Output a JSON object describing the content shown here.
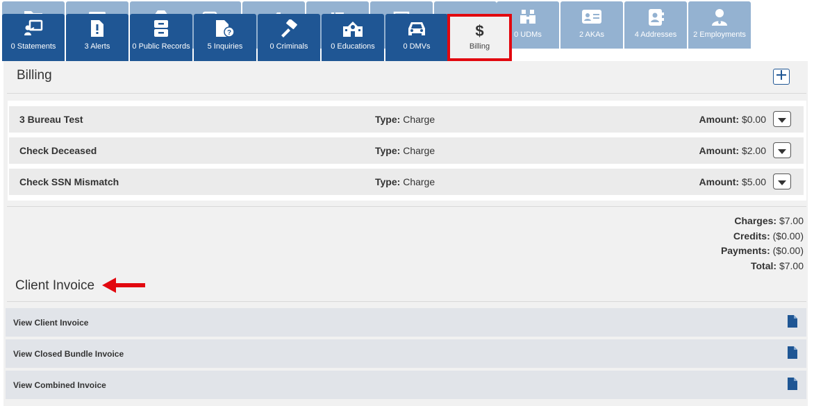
{
  "colors": {
    "tab_active_blue": "#1f5694",
    "tab_back_blue": "#94b2d1",
    "highlight_red": "#e2080f",
    "panel_bg": "#f1f1f1"
  },
  "back_tabs": [
    {
      "label": "",
      "icon": "folder-icon"
    },
    {
      "label": "",
      "icon": "card-icon"
    },
    {
      "label": "",
      "icon": "box-icon"
    },
    {
      "label": "",
      "icon": "stack-icon"
    },
    {
      "label": "",
      "icon": "tag-icon"
    },
    {
      "label": "",
      "icon": "list-icon"
    },
    {
      "label": "",
      "icon": "monitor-icon"
    },
    {
      "label": "",
      "icon": "tray-icon"
    },
    {
      "label": "0 UDMs",
      "icon": "binoculars-icon"
    },
    {
      "label": "2 AKAs",
      "icon": "id-card-icon"
    },
    {
      "label": "4 Addresses",
      "icon": "address-book-icon"
    },
    {
      "label": "2 Employments",
      "icon": "employee-icon"
    }
  ],
  "front_tabs": [
    {
      "label": "0 Statements",
      "icon": "presentation-icon"
    },
    {
      "label": "3 Alerts",
      "icon": "alert-file-icon"
    },
    {
      "label": "0 Public Records",
      "icon": "cabinet-icon"
    },
    {
      "label": "5 Inquiries",
      "icon": "question-file-icon"
    },
    {
      "label": "0 Criminals",
      "icon": "gavel-icon"
    },
    {
      "label": "0 Educations",
      "icon": "school-icon"
    },
    {
      "label": "0 DMVs",
      "icon": "car-icon"
    },
    {
      "label": "Billing",
      "icon": "dollar-icon",
      "symbol": "$"
    }
  ],
  "billing": {
    "title": "Billing",
    "charges": [
      {
        "name": "3 Bureau Test",
        "type_label": "Type:",
        "type": "Charge",
        "amount_label": "Amount:",
        "amount": "$0.00"
      },
      {
        "name": "Check Deceased",
        "type_label": "Type:",
        "type": "Charge",
        "amount_label": "Amount:",
        "amount": "$2.00"
      },
      {
        "name": "Check SSN Mismatch",
        "type_label": "Type:",
        "type": "Charge",
        "amount_label": "Amount:",
        "amount": "$5.00"
      }
    ],
    "totals": [
      {
        "label": "Charges:",
        "value": "$7.00"
      },
      {
        "label": "Credits:",
        "value": "($0.00)"
      },
      {
        "label": "Payments:",
        "value": "($0.00)"
      },
      {
        "label": "Total:",
        "value": "$7.00"
      }
    ]
  },
  "client_invoice": {
    "title": "Client Invoice",
    "rows": [
      {
        "label": "View Client Invoice"
      },
      {
        "label": "View Closed Bundle Invoice"
      },
      {
        "label": "View Combined Invoice"
      }
    ]
  }
}
